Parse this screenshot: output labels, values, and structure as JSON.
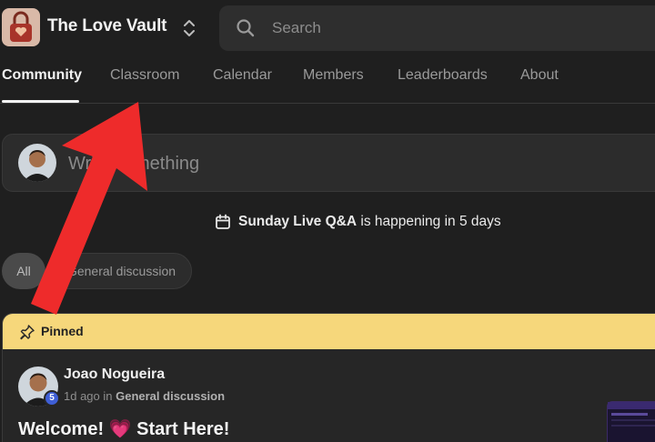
{
  "header": {
    "app_title": "The Love Vault",
    "search_placeholder": "Search"
  },
  "tabs": [
    {
      "label": "Community",
      "active": true
    },
    {
      "label": "Classroom",
      "active": false
    },
    {
      "label": "Calendar",
      "active": false
    },
    {
      "label": "Members",
      "active": false
    },
    {
      "label": "Leaderboards",
      "active": false
    },
    {
      "label": "About",
      "active": false
    }
  ],
  "composer": {
    "placeholder": "Write something"
  },
  "event": {
    "name": "Sunday Live Q&A",
    "suffix": " is happening in 5 days"
  },
  "filters": [
    {
      "label": "All",
      "selected": true
    },
    {
      "label": "General discussion",
      "selected": false
    }
  ],
  "post": {
    "pinned_label": "Pinned",
    "author": "Joao Nogueira",
    "level": "5",
    "time": "1d ago",
    "in_word": " in ",
    "category": "General discussion",
    "title_before": "Welcome! ",
    "title_emoji": "💗",
    "title_after": " Start Here!"
  },
  "colors": {
    "background": "#1f1f1f",
    "pinned": "#f6d77b",
    "level_badge": "#3f5fd6",
    "annotation_arrow": "#ee2b2b"
  }
}
